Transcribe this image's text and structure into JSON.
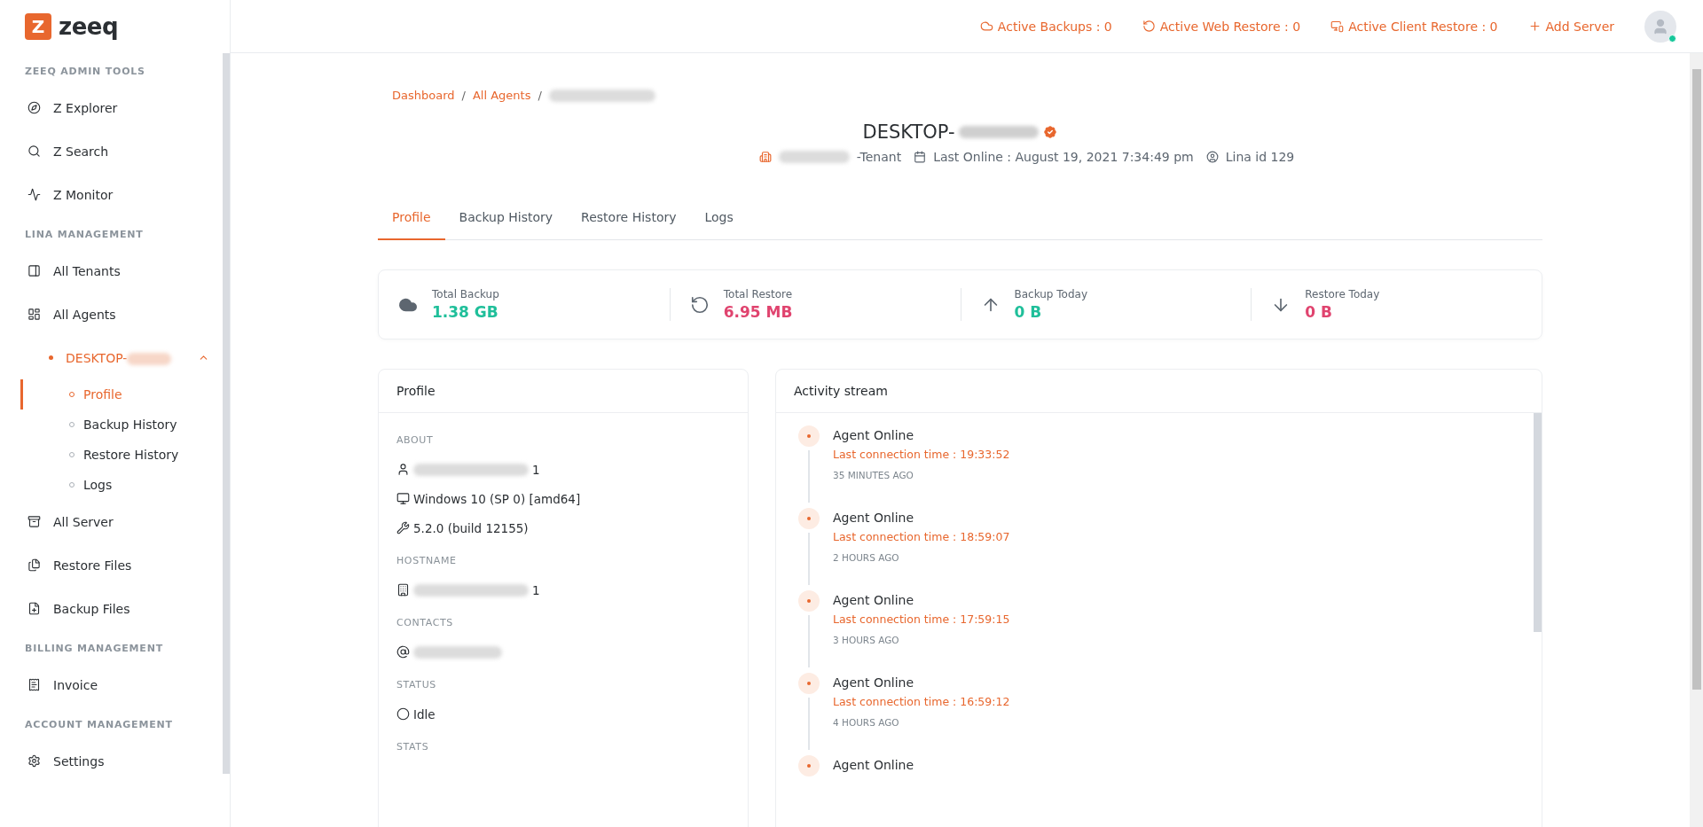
{
  "logo": {
    "mark": "Z",
    "text": "zeeq"
  },
  "header": {
    "items": [
      {
        "kind": "cloud",
        "label": "Active Backups : 0"
      },
      {
        "kind": "restore",
        "label": "Active Web Restore : 0"
      },
      {
        "kind": "devices",
        "label": "Active Client Restore : 0"
      },
      {
        "kind": "plus",
        "label": "Add Server"
      }
    ],
    "user": {
      "online": true
    }
  },
  "sidebar": {
    "sections": [
      {
        "title": "ZEEQ ADMIN TOOLS",
        "items": [
          {
            "kind": "compass",
            "label": "Z Explorer",
            "selected": false
          },
          {
            "kind": "search",
            "label": "Z Search",
            "selected": false
          },
          {
            "kind": "pulse",
            "label": "Z Monitor",
            "selected": false
          }
        ]
      },
      {
        "title": "LINA MANAGEMENT",
        "items": [
          {
            "kind": "panel",
            "label": "All Tenants",
            "selected": false
          },
          {
            "kind": "layout",
            "label": "All Agents",
            "selected": false
          },
          {
            "kind": "dot",
            "label": "DESKTOP-",
            "redacted": true,
            "selected": true,
            "expanded": true,
            "children": [
              {
                "label": "Profile",
                "selected": true
              },
              {
                "label": "Backup History",
                "selected": false
              },
              {
                "label": "Restore History",
                "selected": false
              },
              {
                "label": "Logs",
                "selected": false
              }
            ]
          },
          {
            "kind": "server",
            "label": "All Server",
            "selected": false
          },
          {
            "kind": "files",
            "label": "Restore Files",
            "selected": false
          },
          {
            "kind": "fileplus",
            "label": "Backup Files",
            "selected": false
          }
        ]
      },
      {
        "title": "BILLING MANAGEMENT",
        "items": [
          {
            "kind": "receipt",
            "label": "Invoice",
            "selected": false
          }
        ]
      },
      {
        "title": "ACCOUNT MANAGEMENT",
        "items": [
          {
            "kind": "settings",
            "label": "Settings",
            "selected": false
          }
        ]
      }
    ]
  },
  "breadcrumb": [
    {
      "label": "Dashboard",
      "separator": "/"
    },
    {
      "label": "All Agents",
      "separator": "/"
    }
  ],
  "agent": {
    "name": "DESKTOP-",
    "verified": true,
    "tenant": "-Tenant",
    "last_online": "Last Online : August 19, 2021 7:34:49 pm",
    "lina_id": "Lina id 129"
  },
  "tabs": [
    {
      "label": "Profile",
      "selected": true
    },
    {
      "label": "Backup History",
      "selected": false
    },
    {
      "label": "Restore History",
      "selected": false
    },
    {
      "label": "Logs",
      "selected": false
    }
  ],
  "stats": [
    {
      "kind": "cloud",
      "label": "Total Backup",
      "value": "1.38 GB",
      "color": "#1fbf9a"
    },
    {
      "kind": "restore",
      "label": "Total Restore",
      "value": "6.95 MB",
      "color": "#e0446f"
    },
    {
      "kind": "up",
      "label": "Backup Today",
      "value": "0 B",
      "color": "#1fbf9a"
    },
    {
      "kind": "down",
      "label": "Restore Today",
      "value": "0 B",
      "color": "#e0446f"
    }
  ],
  "profile": {
    "title": "Profile",
    "sections": [
      {
        "heading": "ABOUT",
        "rows": [
          {
            "kind": "user",
            "text": "1",
            "redacted": true
          },
          {
            "kind": "monitor",
            "text": "Windows 10 (SP 0) [amd64]",
            "redacted": false
          },
          {
            "kind": "tools",
            "text": "5.2.0 (build 12155)",
            "redacted": false
          }
        ]
      },
      {
        "heading": "HOSTNAME",
        "rows": [
          {
            "kind": "building",
            "text": "1",
            "redacted": true
          }
        ]
      },
      {
        "heading": "CONTACTS",
        "rows": [
          {
            "kind": "at",
            "redacted": true
          }
        ]
      },
      {
        "heading": "STATUS",
        "rows": [
          {
            "kind": "circle",
            "text": "Idle",
            "redacted": false
          }
        ]
      },
      {
        "heading": "STATS"
      }
    ]
  },
  "activity": {
    "title": "Activity stream",
    "items": [
      {
        "title": "Agent Online",
        "detail": "Last connection time : 19:33:52",
        "ago": "35 MINUTES AGO"
      },
      {
        "title": "Agent Online",
        "detail": "Last connection time : 18:59:07",
        "ago": "2 HOURS AGO"
      },
      {
        "title": "Agent Online",
        "detail": "Last connection time : 17:59:15",
        "ago": "3 HOURS AGO"
      },
      {
        "title": "Agent Online",
        "detail": "Last connection time : 16:59:12",
        "ago": "4 HOURS AGO"
      },
      {
        "title": "Agent Online"
      }
    ]
  }
}
